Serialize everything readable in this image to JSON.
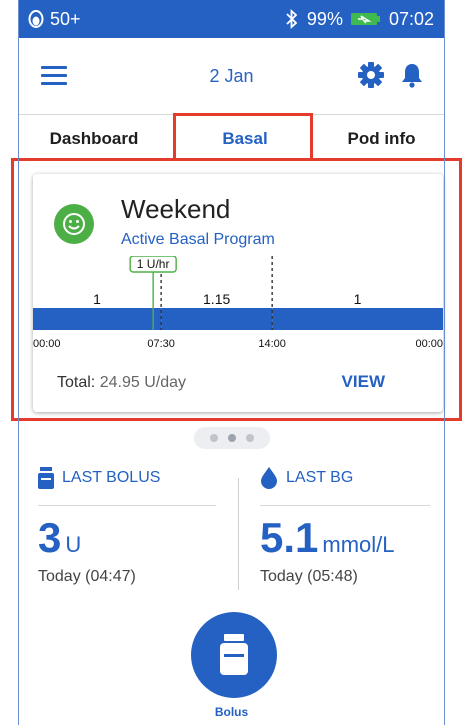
{
  "status_bar": {
    "pod_status": "50+",
    "battery_percent": "99%",
    "time": "07:02",
    "bluetooth_icon": "bluetooth-icon",
    "battery_icon": "battery-charging-icon",
    "pod_icon": "pod-icon"
  },
  "header": {
    "date": "2 Jan",
    "menu_icon": "menu-icon",
    "settings_icon": "gear-icon",
    "notifications_icon": "bell-icon"
  },
  "tabs": [
    {
      "label": "Dashboard",
      "selected": false
    },
    {
      "label": "Basal",
      "selected": true
    },
    {
      "label": "Pod info",
      "selected": false
    }
  ],
  "basal_card": {
    "program_icon": "smiley-icon",
    "program_name": "Weekend",
    "status": "Active Basal Program",
    "current_rate_label": "1 U/hr",
    "total_label": "Total:",
    "total_value": "24.95 U/day",
    "view_label": "VIEW"
  },
  "chart_data": {
    "type": "bar",
    "segments": [
      {
        "start": "00:00",
        "end": "07:30",
        "rate_label": "1"
      },
      {
        "start": "07:30",
        "end": "14:00",
        "rate_label": "1.15"
      },
      {
        "start": "14:00",
        "end": "24:00",
        "rate_label": "1"
      }
    ],
    "x_ticks": [
      "00:00",
      "07:30",
      "14:00",
      "00:00"
    ],
    "current_time_marker": "07:02",
    "current_rate": "1 U/hr",
    "bar_color": "#2461c3"
  },
  "pager": {
    "count": 3,
    "active_index": 1
  },
  "last_bolus": {
    "icon": "bolus-vial-icon",
    "title": "LAST BOLUS",
    "value": "3",
    "unit": "U",
    "time": "Today (04:47)"
  },
  "last_bg": {
    "icon": "blood-drop-icon",
    "title": "LAST BG",
    "value": "5.1",
    "unit": "mmol/L",
    "time": "Today (05:48)"
  },
  "bolus_button": {
    "icon": "bolus-vial-icon",
    "label": "Bolus"
  },
  "colors": {
    "primary": "#2461c3",
    "highlight": "#e53b2c",
    "smiley": "#4caf46",
    "current_marker": "#4caf46"
  }
}
